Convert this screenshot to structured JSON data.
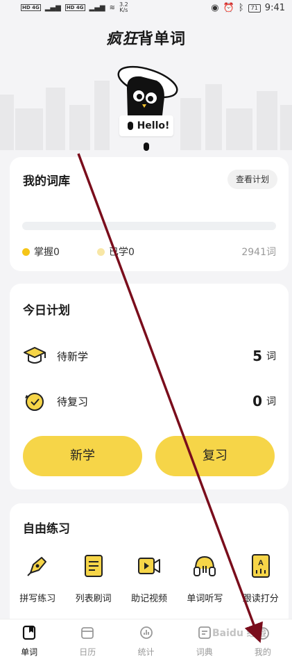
{
  "status_bar": {
    "network_1": "HD 4G",
    "network_2": "HD 4G",
    "speed": "3.2\nK/s",
    "battery": "71",
    "time": "9:41"
  },
  "app": {
    "title_italic": "疯狂",
    "title_rest": "背单词",
    "mascot_greeting": "Hello!"
  },
  "library": {
    "title": "我的词库",
    "plan_button": "查看计划",
    "progress_fraction": 0,
    "mastered": "掌握0",
    "learned": "已学0",
    "total": "2941词",
    "mastered_color": "#f5c518",
    "learned_color": "#f8e7a6"
  },
  "today": {
    "title": "今日计划",
    "tasks": [
      {
        "label": "待新学",
        "count": "5",
        "unit": "词",
        "icon": "graduation-cap-icon"
      },
      {
        "label": "待复习",
        "count": "0",
        "unit": "词",
        "icon": "review-clock-icon"
      }
    ],
    "new_button": "新学",
    "review_button": "复习"
  },
  "practice": {
    "title": "自由练习",
    "items": [
      {
        "label": "拼写练习",
        "icon": "pen-icon"
      },
      {
        "label": "列表刷词",
        "icon": "list-icon"
      },
      {
        "label": "助记视频",
        "icon": "video-icon"
      },
      {
        "label": "单词听写",
        "icon": "headphones-icon"
      },
      {
        "label": "跟读打分",
        "icon": "read-score-icon"
      }
    ]
  },
  "tabs": [
    {
      "label": "单词",
      "icon": "book-icon",
      "active": true
    },
    {
      "label": "日历",
      "icon": "calendar-icon",
      "active": false
    },
    {
      "label": "统计",
      "icon": "stats-icon",
      "active": false
    },
    {
      "label": "词典",
      "icon": "dictionary-icon",
      "active": false
    },
    {
      "label": "我的",
      "icon": "profile-icon",
      "active": false
    }
  ],
  "colors": {
    "accent_yellow": "#f6d548",
    "annotation_arrow": "#7a0d1c"
  }
}
